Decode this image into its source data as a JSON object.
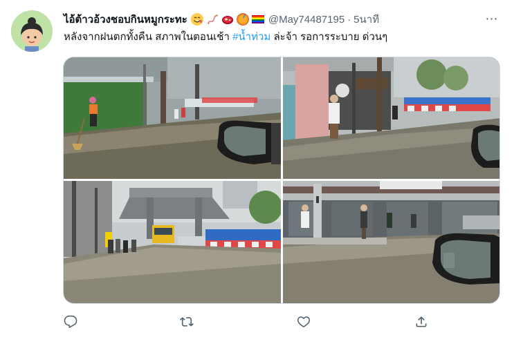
{
  "tweet": {
    "author": {
      "display_name": "ไอ้ต้าวอ้วงชอบกินหมูกระทะ",
      "emojis": [
        "smiling-face-icon",
        "bacon-icon",
        "meat-icon",
        "thai-tea-icon",
        "rainbow-flag-icon"
      ],
      "handle": "@May74487195",
      "separator": "·",
      "time": "5นาที"
    },
    "more_icon": "⋯",
    "text_before": "หลังจากฝนตกทั้งคืน สภาพในตอนเช้า ",
    "hashtag": "#น้ำท่วม",
    "text_after": " ล่ะจ้า รอการระบาย ด่วนๆ",
    "photos": [
      "flooded-sidewalk-photo",
      "flooded-gate-photo",
      "flooded-street-photo",
      "flooded-shophouse-photo"
    ],
    "actions": [
      "reply-icon",
      "retweet-icon",
      "like-icon",
      "share-icon"
    ],
    "colors": {
      "link": "#1d9bf0",
      "secondary": "#536471",
      "text": "#0f1419"
    }
  }
}
